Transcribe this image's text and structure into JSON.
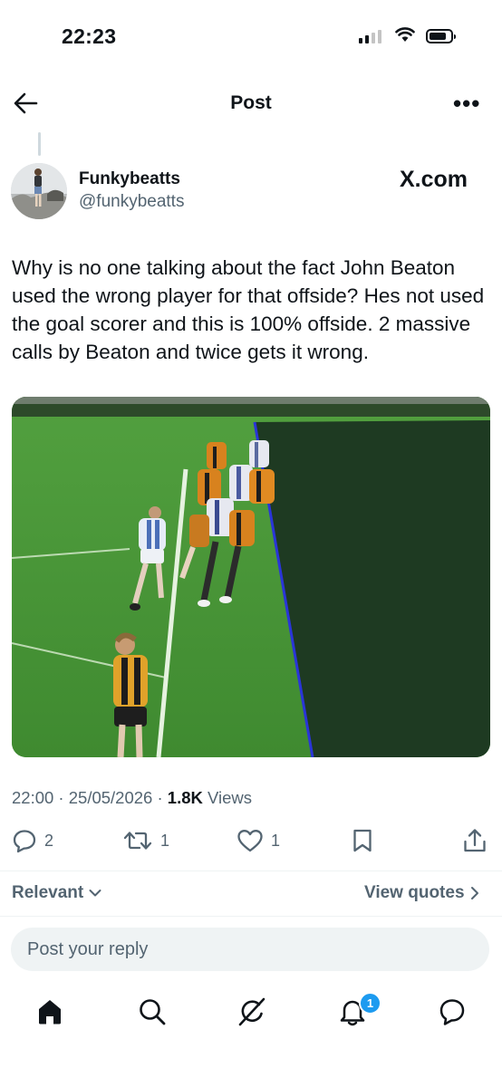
{
  "status_bar": {
    "time": "22:23"
  },
  "header": {
    "title": "Post"
  },
  "author": {
    "display_name": "Funkybeatts",
    "handle": "@funkybeatts",
    "source_badge": "X.com"
  },
  "post": {
    "text": "Why is no one talking about the fact John Beaton used the wrong player for that offside? Hes not used the goal scorer and this is 100% offside. 2 massive calls by Beaton and twice gets it wrong.",
    "time": "22:00",
    "date": "25/05/2026",
    "views_count": "1.8K",
    "views_label": "Views"
  },
  "actions": {
    "replies": "2",
    "reposts": "1",
    "likes": "1"
  },
  "replies_section": {
    "sort_label": "Relevant",
    "view_quotes_label": "View quotes",
    "reply_placeholder": "Post your reply"
  },
  "bottom_nav": {
    "notifications_badge": "1",
    "items": [
      "home-icon",
      "search-icon",
      "grok-icon",
      "notifications-icon",
      "messages-icon"
    ]
  },
  "colors": {
    "text": "#0f1419",
    "secondary": "#536471",
    "accent": "#1d9bf0"
  }
}
